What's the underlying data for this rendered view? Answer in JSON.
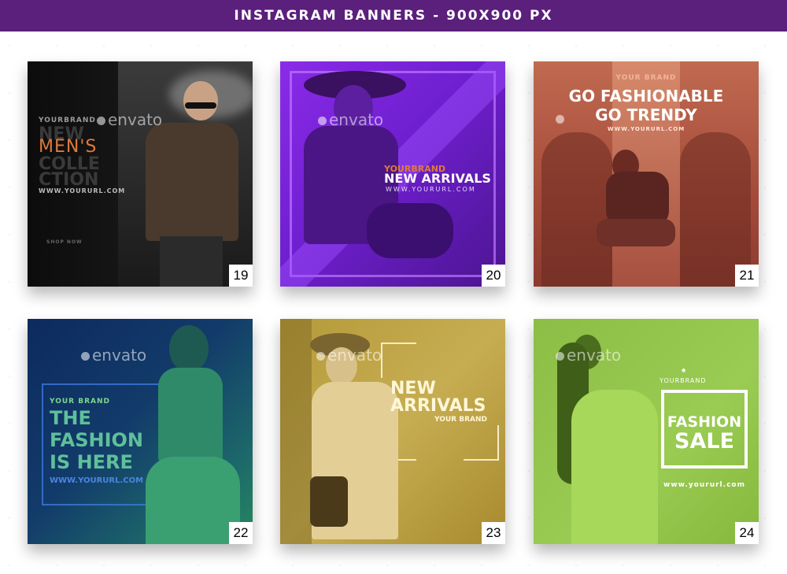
{
  "header": {
    "title": "INSTAGRAM BANNERS - 900X900 PX"
  },
  "watermark": "envato",
  "cards": [
    {
      "number": "19",
      "brand": "YOURBRAND",
      "line1": "NEW",
      "line2": "MEN'S",
      "line3": "COLLE",
      "line4": "CTION",
      "url": "WWW.YOURURL.COM",
      "cta": "SHOP NOW"
    },
    {
      "number": "20",
      "brand": "YOURBRAND",
      "headline": "NEW ARRIVALS",
      "url": "WWW.YOURURL.COM"
    },
    {
      "number": "21",
      "brand": "YOUR BRAND",
      "line1": "GO FASHIONABLE",
      "line2": "GO TRENDY",
      "url": "WWW.YOURURL.COM"
    },
    {
      "number": "22",
      "brand": "YOUR BRAND",
      "line1": "THE",
      "line2": "FASHION",
      "line3": "IS HERE",
      "url": "WWW.YOURURL.COM"
    },
    {
      "number": "23",
      "line1": "NEW",
      "line2": "ARRIVALS",
      "brand": "YOUR BRAND"
    },
    {
      "number": "24",
      "brand": "YOURBRAND",
      "line1": "FASHION",
      "line2": "SALE",
      "url": "www.yoururl.com"
    }
  ],
  "colors": {
    "header": "#5b1f7c",
    "accent_orange": "#e07a3c",
    "card20": "#7a2ae0",
    "card21": "#b05a44",
    "card22": "#13406a",
    "card23": "#b89c3e",
    "card24": "#90c04a"
  }
}
